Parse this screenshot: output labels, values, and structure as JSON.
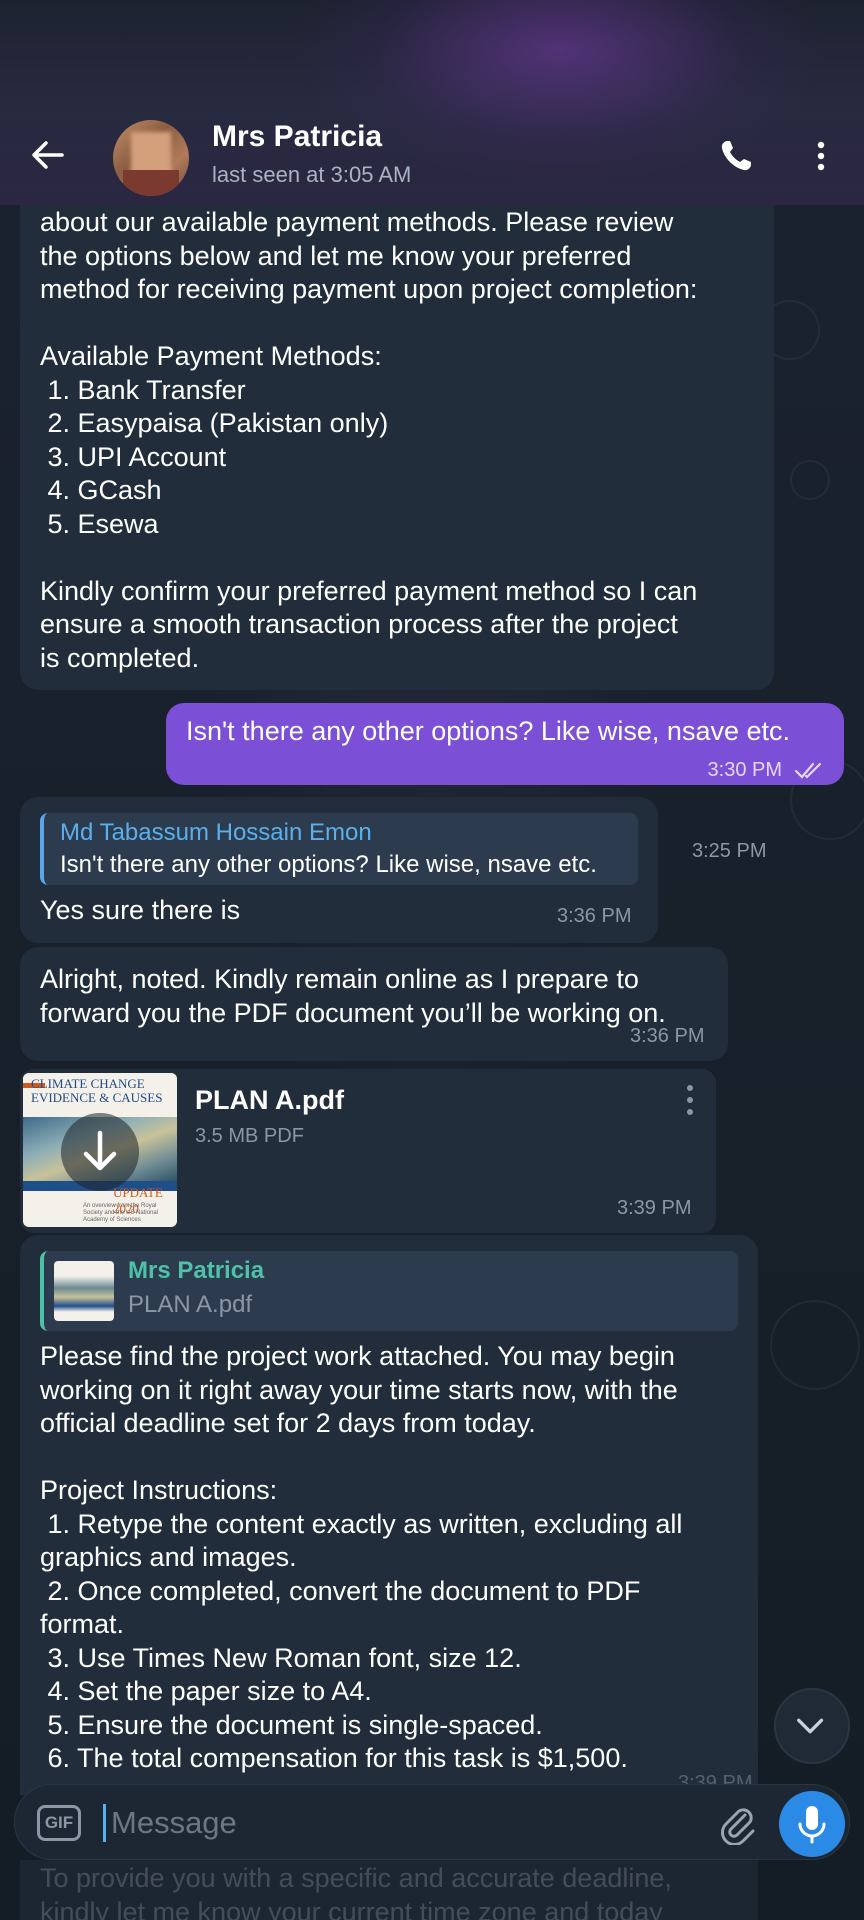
{
  "header": {
    "name": "Mrs Patricia",
    "status": "last seen at 3:05 AM"
  },
  "messages": {
    "m1": {
      "text": "about our available payment methods. Please review\nthe options below and let me know your preferred\nmethod for receiving payment upon project completion:\n\nAvailable Payment Methods:\n 1. Bank Transfer\n 2. Easypaisa (Pakistan only)\n 3. UPI Account\n 4. GCash\n 5. Esewa\n\nKindly confirm your preferred payment method so I can\nensure a smooth transaction process after the project\nis completed.",
      "time": "3:25 PM"
    },
    "m2": {
      "text": "Isn't there any other options? Like wise, nsave etc.",
      "time": "3:30 PM",
      "status": "read"
    },
    "m3": {
      "reply_name": "Md Tabassum Hossain Emon",
      "reply_text": "Isn't there any other options? Like wise, nsave etc.",
      "text": "Yes sure there is",
      "time": "3:36 PM"
    },
    "m4": {
      "text": "Alright, noted. Kindly remain online as I prepare to\nforward you the PDF document you’ll be working on.",
      "time": "3:36 PM"
    },
    "m5": {
      "file_name": "PLAN A.pdf",
      "file_size": "3.5 MB PDF",
      "thumb_title": "CLIMATE CHANGE\nEVIDENCE & CAUSES",
      "thumb_year": "UPDATE 2020",
      "thumb_sub": "An overview from the Royal Society and the US National Academy of Sciences",
      "time": "3:39 PM"
    },
    "m6": {
      "quote_name": "Mrs Patricia",
      "quote_file": "PLAN A.pdf",
      "text": "Please find the project work attached. You may begin\nworking on it right away your time starts now, with the\nofficial deadline set for 2 days from today.\n\nProject Instructions:\n 1. Retype the content exactly as written, excluding all\ngraphics and images.\n 2. Once completed, convert the document to PDF\nformat.\n 3. Use Times New Roman font, size 12.\n 4. Set the paper size to A4.\n 5. Ensure the document is single-spaced.\n 6. The total compensation for this task is $1,500.",
      "time": "3:39 PM"
    },
    "m7": {
      "text": "To provide you with a specific and accurate deadline,\nkindly let me know your current time zone and today"
    }
  },
  "input": {
    "gif_label": "GIF",
    "placeholder": "Message",
    "value": ""
  },
  "colors": {
    "outgoing_bubble": "#7b4fd6",
    "incoming_bubble": "#212d3b",
    "accent": "#2b8ae6"
  },
  "icons": {
    "back": "arrow-left-icon",
    "call": "phone-icon",
    "more": "vertical-dots-icon",
    "download": "download-arrow-icon",
    "scroll_down": "chevron-down-icon",
    "attach": "paperclip-icon",
    "mic": "microphone-icon",
    "read": "double-check-icon"
  }
}
